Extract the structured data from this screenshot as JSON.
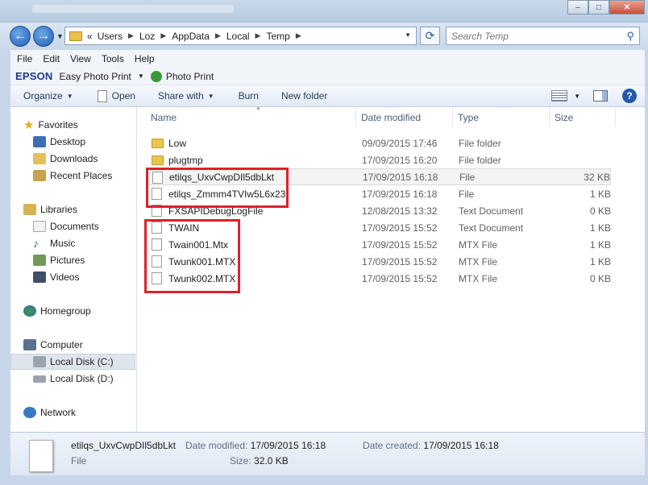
{
  "window": {
    "minimize": "–",
    "maximize": "□",
    "close": "✕"
  },
  "nav": {
    "back": "←",
    "forward": "→",
    "breadcrumbs": [
      "«",
      "Users",
      "Loz",
      "AppData",
      "Local",
      "Temp"
    ],
    "search_placeholder": "Search Temp"
  },
  "menu": [
    "File",
    "Edit",
    "View",
    "Tools",
    "Help"
  ],
  "epson": {
    "brand": "EPSON",
    "easy_photo_print": "Easy Photo Print",
    "photo_print": "Photo Print"
  },
  "toolbar": {
    "organize": "Organize",
    "open": "Open",
    "share_with": "Share with",
    "burn": "Burn",
    "new_folder": "New folder"
  },
  "sidebar": {
    "favorites": "Favorites",
    "desktop": "Desktop",
    "downloads": "Downloads",
    "recent_places": "Recent Places",
    "libraries": "Libraries",
    "documents": "Documents",
    "music": "Music",
    "pictures": "Pictures",
    "videos": "Videos",
    "homegroup": "Homegroup",
    "computer": "Computer",
    "local_disk_c": "Local Disk (C:)",
    "local_disk_d": "Local Disk (D:)",
    "network": "Network"
  },
  "columns": {
    "name": "Name",
    "date_modified": "Date modified",
    "type": "Type",
    "size": "Size"
  },
  "files": [
    {
      "name": "Low",
      "date": "09/09/2015 17:46",
      "type": "File folder",
      "size": "",
      "icon": "folder-icon"
    },
    {
      "name": "plugtmp",
      "date": "17/09/2015 16:20",
      "type": "File folder",
      "size": "",
      "icon": "folder-icon"
    },
    {
      "name": "etilqs_UxvCwpDIl5dbLkt",
      "date": "17/09/2015 16:18",
      "type": "File",
      "size": "32 KB",
      "icon": "file-icon"
    },
    {
      "name": "etilqs_Zmmm4TVIw5L6x23",
      "date": "17/09/2015 16:18",
      "type": "File",
      "size": "1 KB",
      "icon": "file-icon"
    },
    {
      "name": "FXSAPIDebugLogFile",
      "date": "12/08/2015 13:32",
      "type": "Text Document",
      "size": "0 KB",
      "icon": "text-document-icon"
    },
    {
      "name": "TWAIN",
      "date": "17/09/2015 15:52",
      "type": "Text Document",
      "size": "1 KB",
      "icon": "text-document-icon"
    },
    {
      "name": "Twain001.Mtx",
      "date": "17/09/2015 15:52",
      "type": "MTX File",
      "size": "1 KB",
      "icon": "file-icon"
    },
    {
      "name": "Twunk001.MTX",
      "date": "17/09/2015 15:52",
      "type": "MTX File",
      "size": "1 KB",
      "icon": "file-icon"
    },
    {
      "name": "Twunk002.MTX",
      "date": "17/09/2015 15:52",
      "type": "MTX File",
      "size": "0 KB",
      "icon": "file-icon"
    }
  ],
  "details": {
    "name": "etilqs_UxvCwpDIl5dbLkt",
    "type": "File",
    "date_modified_label": "Date modified:",
    "date_modified": "17/09/2015 16:18",
    "date_created_label": "Date created:",
    "date_created": "17/09/2015 16:18",
    "size_label": "Size:",
    "size": "32.0 KB"
  },
  "colors": {
    "highlight_box": "#e0202a",
    "selected_row": "#f3f3f3"
  }
}
